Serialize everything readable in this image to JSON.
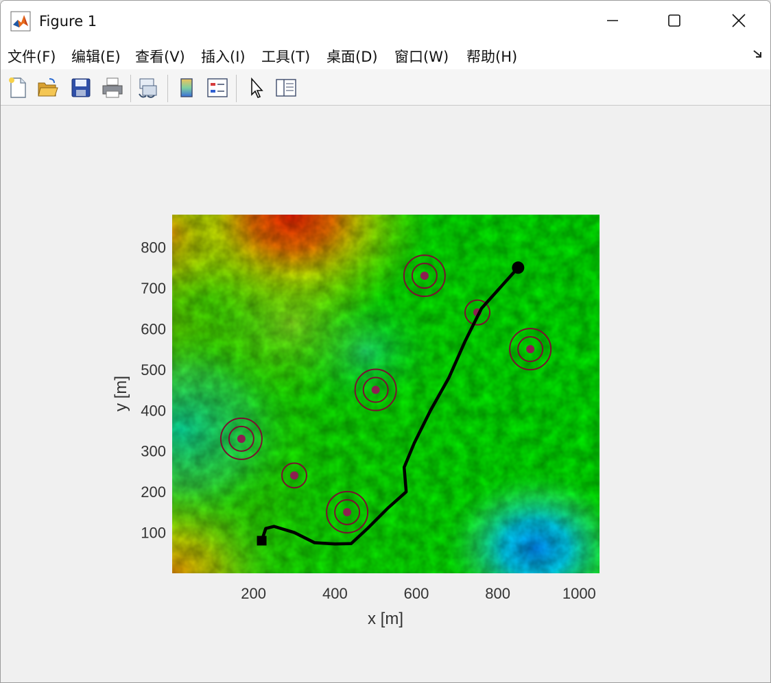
{
  "window": {
    "title": "Figure 1",
    "controls": {
      "minimize": "—",
      "maximize": "☐",
      "close": "✕"
    }
  },
  "menu": [
    {
      "label": "文件(F)"
    },
    {
      "label": "编辑(E)"
    },
    {
      "label": "查看(V)"
    },
    {
      "label": "插入(I)"
    },
    {
      "label": "工具(T)"
    },
    {
      "label": "桌面(D)"
    },
    {
      "label": "窗口(W)"
    },
    {
      "label": "帮助(H)"
    }
  ],
  "menu_overflow_icon": "dock-arrow-icon",
  "toolbar": [
    {
      "name": "new-figure-icon"
    },
    {
      "name": "open-file-icon"
    },
    {
      "name": "save-icon"
    },
    {
      "name": "print-icon"
    },
    {
      "name": "link-plot-icon"
    },
    {
      "name": "colorbar-icon"
    },
    {
      "name": "legend-icon"
    },
    {
      "name": "edit-plot-arrow-icon"
    },
    {
      "name": "property-inspector-icon"
    }
  ],
  "chart_data": {
    "type": "scatter",
    "background": "terrain elevation map (jet colormap, hillshaded)",
    "title": "",
    "xlabel": "x [m]",
    "ylabel": "y [m]",
    "xlim": [
      0,
      1050
    ],
    "ylim": [
      0,
      880
    ],
    "xticks": [
      200,
      400,
      600,
      800,
      1000
    ],
    "yticks": [
      100,
      200,
      300,
      400,
      500,
      600,
      700,
      800
    ],
    "grid": false,
    "obstacles": [
      {
        "x": 620,
        "y": 730,
        "rings": 2
      },
      {
        "x": 750,
        "y": 640,
        "rings": 1
      },
      {
        "x": 880,
        "y": 550,
        "rings": 2
      },
      {
        "x": 500,
        "y": 450,
        "rings": 2
      },
      {
        "x": 170,
        "y": 330,
        "rings": 2
      },
      {
        "x": 300,
        "y": 240,
        "rings": 1
      },
      {
        "x": 430,
        "y": 150,
        "rings": 2
      }
    ],
    "path": {
      "x": [
        220,
        230,
        250,
        300,
        350,
        400,
        440,
        480,
        530,
        575,
        570,
        595,
        635,
        680,
        720,
        760,
        850
      ],
      "y": [
        80,
        110,
        115,
        100,
        75,
        72,
        73,
        110,
        160,
        200,
        260,
        320,
        400,
        480,
        570,
        650,
        750
      ]
    },
    "start": {
      "x": 220,
      "y": 80,
      "marker": "square"
    },
    "goal": {
      "x": 850,
      "y": 750,
      "marker": "circle"
    },
    "colors": {
      "path": "#000000",
      "obstacle_ring": "#7a1030",
      "obstacle_center": "#8b2050"
    }
  }
}
